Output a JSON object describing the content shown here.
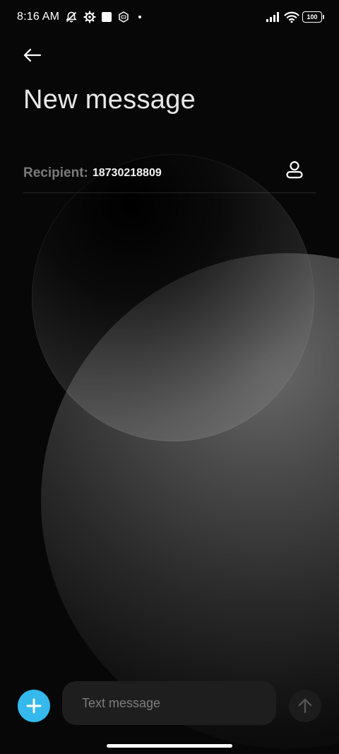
{
  "status_bar": {
    "time": "8:16 AM",
    "battery": "100",
    "icons": [
      "notifications-off-icon",
      "settings-gear-icon",
      "square-icon",
      "nfc-icon",
      "dot-icon",
      "signal-icon",
      "wifi-icon",
      "battery-icon"
    ]
  },
  "header": {
    "back_icon": "back-arrow-icon",
    "title": "New message"
  },
  "recipient": {
    "label": "Recipient:",
    "value": "18730218809",
    "contact_icon": "person-icon"
  },
  "compose": {
    "add_icon": "plus-icon",
    "placeholder": "Text message",
    "send_icon": "arrow-up-icon"
  },
  "colors": {
    "accent": "#35b9ec",
    "background": "#070707",
    "input_background": "#1e1e1e"
  }
}
